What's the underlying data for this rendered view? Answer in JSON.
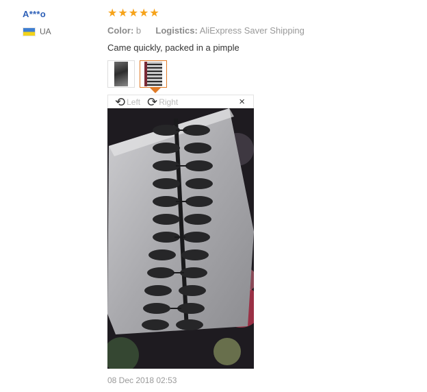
{
  "reviewer": {
    "name": "A***o",
    "country": "UA"
  },
  "rating": {
    "stars": 5,
    "star_color": "#f6a31a"
  },
  "meta": {
    "color_label": "Color:",
    "color_value": "b",
    "logistics_label": "Logistics:",
    "logistics_value": "AliExpress Saver Shipping"
  },
  "review": {
    "text": "Came quickly, packed in a pimple",
    "date": "08 Dec 2018 02:53"
  },
  "gallery": {
    "thumbnails": [
      "thumbnail-1",
      "thumbnail-2"
    ],
    "selected_index": 1,
    "accent_color": "#e07b27"
  },
  "viewer": {
    "rotate_left_label": "Left",
    "rotate_right_label": "Right",
    "close_symbol": "×"
  }
}
